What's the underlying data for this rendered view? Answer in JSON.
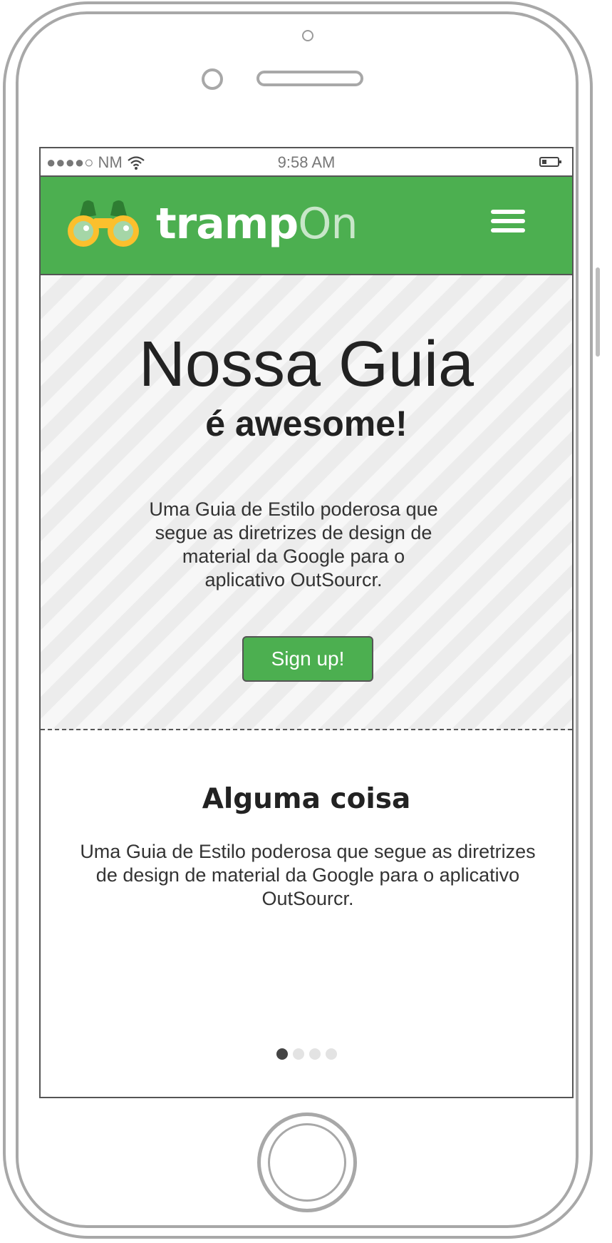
{
  "status_bar": {
    "carrier": "●●●●○ NM",
    "time": "9:58 AM"
  },
  "header": {
    "logo_part1": "tramp",
    "logo_part2": "On",
    "brand_color": "#4caf50",
    "logo_icon": "binoculars-icon",
    "menu_icon": "hamburger-menu-icon"
  },
  "hero": {
    "title": "Nossa Guia",
    "subtitle": "é awesome!",
    "text": "Uma Guia de Estilo poderosa que segue as diretrizes de design de material da Google para o aplicativo OutSourcr.",
    "button_label": "Sign up!"
  },
  "section": {
    "title": "Alguma coisa",
    "text": "Uma Guia de Estilo poderosa que segue as diretrizes de design de material da Google para o aplicativo OutSourcr."
  },
  "pager": {
    "total": 4,
    "active": 1
  }
}
